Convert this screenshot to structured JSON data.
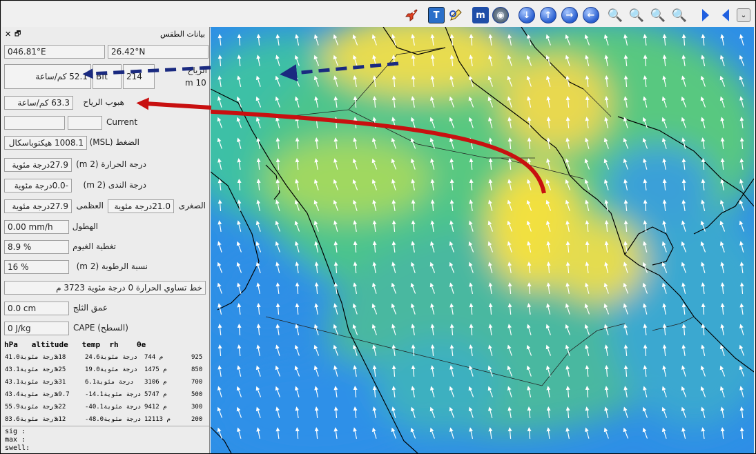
{
  "toolbar": {
    "icons": [
      "rocket-icon",
      "text-icon",
      "edit-icon",
      "m-icon",
      "globe-icon",
      "arrow-down-icon",
      "arrow-up-icon",
      "arrow-right-icon",
      "arrow-left-icon",
      "zoom-1-1-icon",
      "zoom-in-icon",
      "zoom-out-icon",
      "zoom-fit-icon",
      "play-forward-icon",
      "play-back-icon",
      "dropdown-icon"
    ]
  },
  "panel": {
    "title": "بيانات الطقس",
    "close": "✕",
    "restore": "🗗",
    "longitude": "046.81°E",
    "latitude": "26.42°N",
    "wind_speed": "52.1  كم/ساعة",
    "wind_unit_1": "Bft",
    "wind_dir": "214",
    "wind_level_label": "الرياح",
    "wind_level": "m 10",
    "gust": "63.3  كم/ساعة",
    "gust_label": "هبوب الرياح",
    "current_blank1": "",
    "current_blank2": "",
    "current": "Current",
    "pressure": "1008.1  هيكتوباسكال",
    "pressure_label": "الضغط (MSL)",
    "temp": "27.9درجة مئوية",
    "temp_label": "درجة الحرارة (2 m)",
    "dew": "-0.0درجة مئوية",
    "dew_label": "درجة الندى (2 m)",
    "tmax": "27.9درجة مئوية",
    "tmax_label": "العظمى",
    "tmin": "21.0درجة مئوية",
    "tmin_label": "الصغرى",
    "precip": "0.00 mm/h",
    "precip_label": "الهطول",
    "cloud": "8.9 %",
    "cloud_label": "تغطية الغيوم",
    "humidity": "16 %",
    "humidity_label": "نسبة الرطوبة (2 m)",
    "freeze": "خط تساوي الحرارة 0 درجة مئوية   3723 م",
    "snow": "0.0 cm",
    "snow_label": "عمق الثلج",
    "cape": "0 J/kg",
    "cape_label": "CAPE (السطح)"
  },
  "sounding": {
    "header": "hPa   altitude   temp  rh    θe",
    "rows": [
      {
        "thetae": "41.0درجة مئوية",
        "rh": "%18",
        "temp": "24.6درجة مئوية",
        "alt": "744 م",
        "hpa": "925"
      },
      {
        "thetae": "43.1درجة مئوية",
        "rh": "%25",
        "temp": "19.0درجة مئوية",
        "alt": "1475 م",
        "hpa": "850"
      },
      {
        "thetae": "43.1درجة مئوية",
        "rh": "%31",
        "temp": "6.1درجة مئوية",
        "alt": "3106 م",
        "hpa": "700"
      },
      {
        "thetae": "43.4درجة مئوية",
        "rh": "%9.7",
        "temp": "-14.1درجة مئوية",
        "alt": "5747 م",
        "hpa": "500"
      },
      {
        "thetae": "55.9درجة مئوية",
        "rh": "%22",
        "temp": "-40.1درجة مئوية",
        "alt": "9412 م",
        "hpa": "300"
      },
      {
        "thetae": "83.6درجة مئوية",
        "rh": "%12",
        "temp": "-48.0درجة مئوية",
        "alt": "12113 م",
        "hpa": "200"
      }
    ]
  },
  "sig": {
    "sig": "sig :",
    "max": "max :",
    "swell": "swell:"
  },
  "colors": {
    "arrow_blue": "#1a2a80",
    "arrow_red": "#c81010",
    "map_blue": "#2e8fe6",
    "map_green": "#4cc48c",
    "map_yellow": "#f0e040"
  }
}
